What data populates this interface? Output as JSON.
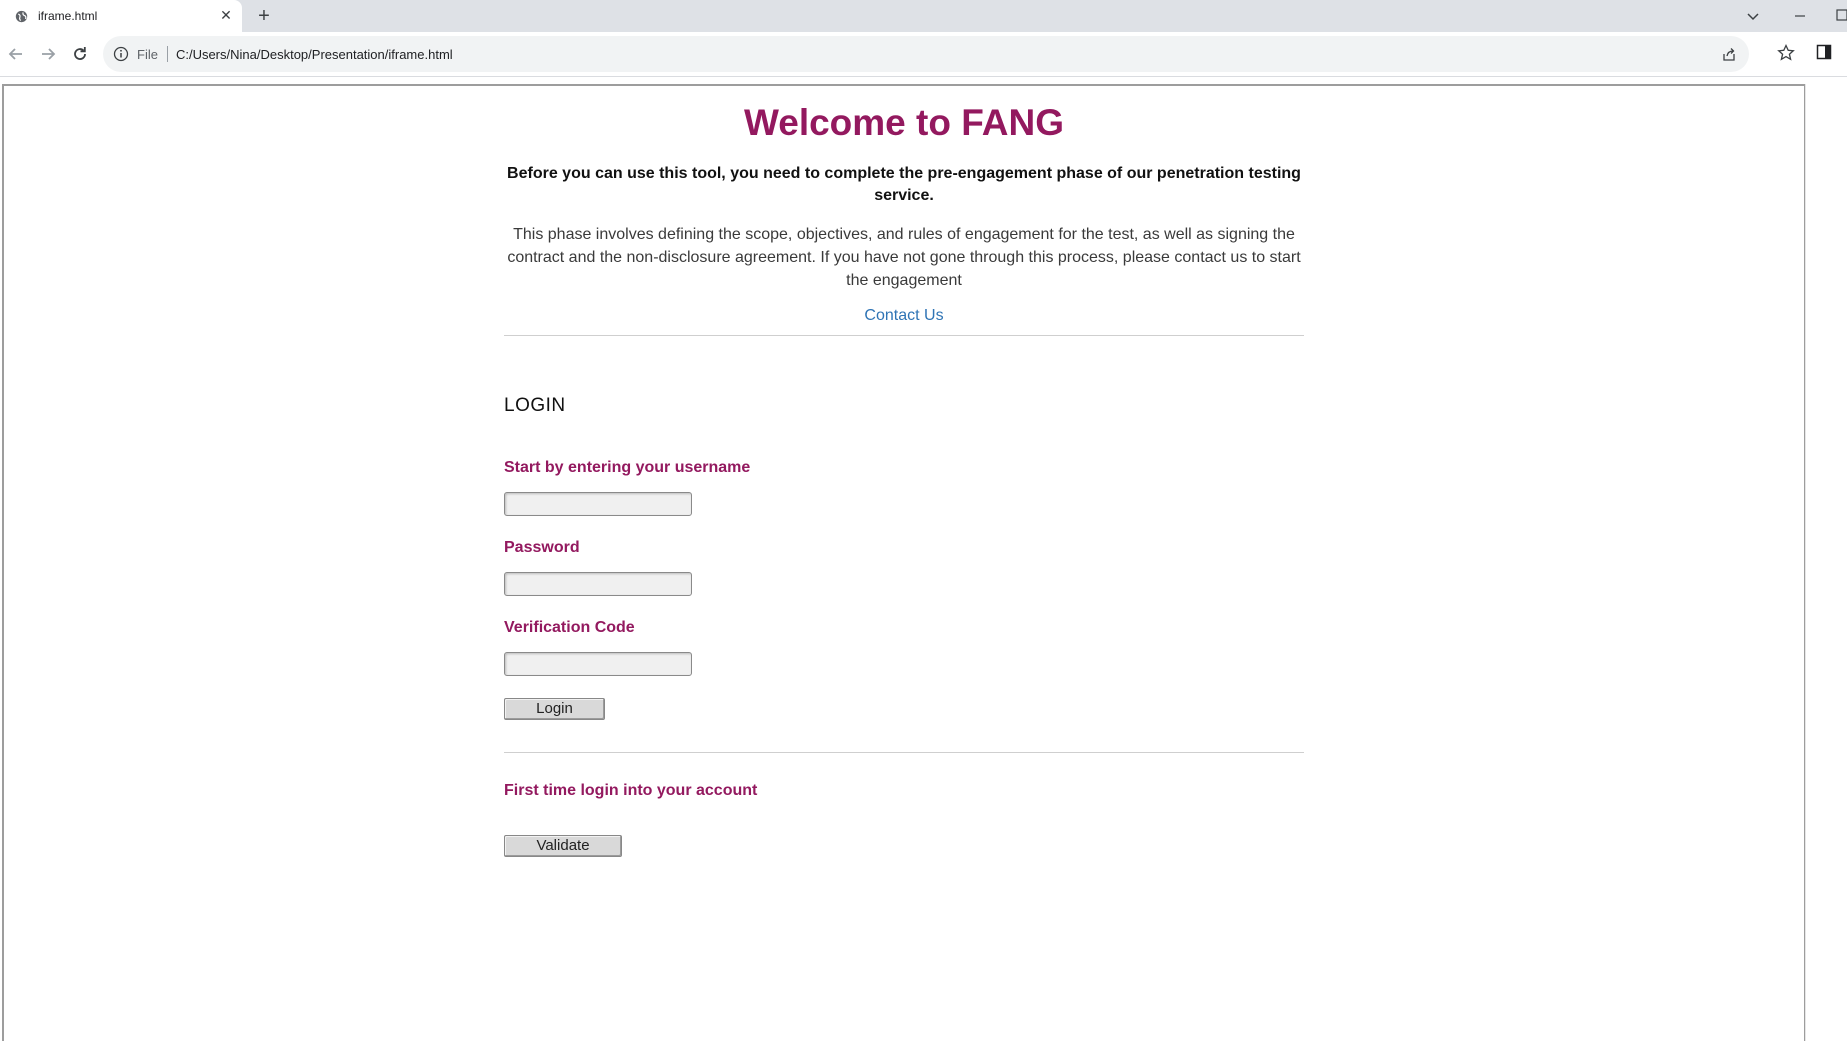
{
  "browser": {
    "tab_title": "iframe.html",
    "scheme_label": "File",
    "url": "C:/Users/Nina/Desktop/Presentation/iframe.html"
  },
  "page": {
    "title": "Welcome to FANG",
    "intro_bold": "Before you can use this tool, you need to complete the pre-engagement phase of our penetration testing service.",
    "intro_text": "This phase involves defining the scope, objectives, and rules of engagement for the test, as well as signing the contract and the non-disclosure agreement. If you have not gone through this process, please contact us to start the engagement",
    "contact_link": "Contact Us"
  },
  "login": {
    "heading": "LOGIN",
    "username_label": "Start by entering your username",
    "username_value": "",
    "password_label": "Password",
    "password_value": "",
    "verification_label": "Verification Code",
    "verification_value": "",
    "login_button": "Login"
  },
  "first_time": {
    "label": "First time login into your account",
    "validate_button": "Validate"
  },
  "colors": {
    "accent": "#93195f",
    "link": "#2f74b5"
  }
}
